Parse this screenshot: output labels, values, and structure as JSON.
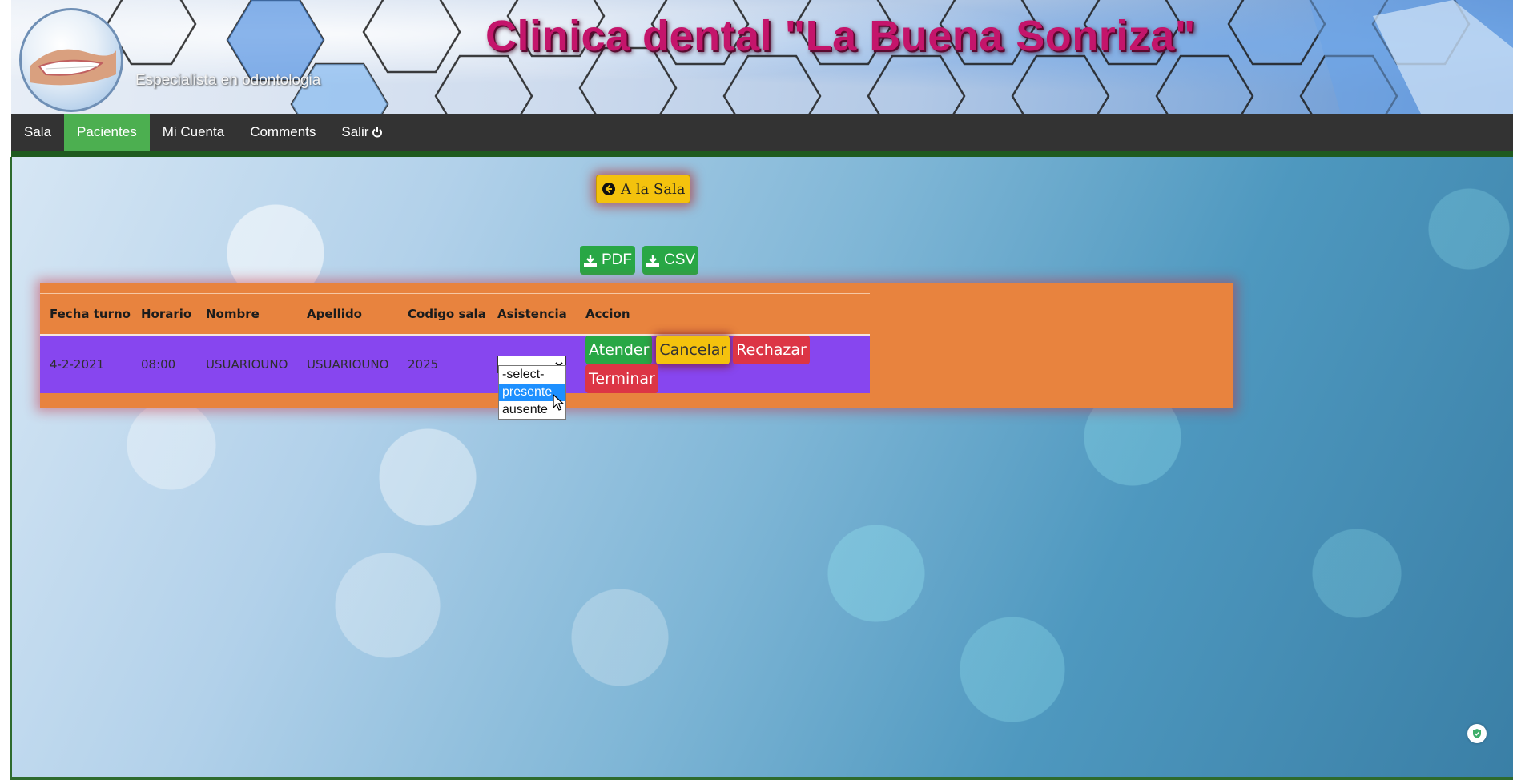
{
  "header": {
    "title": "Clinica dental \"La Buena Sonriza\"",
    "subtitle": "Especialista en odontologia"
  },
  "nav": {
    "items": [
      {
        "label": "Sala",
        "active": false
      },
      {
        "label": "Pacientes",
        "active": true
      },
      {
        "label": "Mi Cuenta",
        "active": false
      },
      {
        "label": "Comments",
        "active": false
      },
      {
        "label": "Salir",
        "active": false,
        "icon": "power-icon"
      }
    ]
  },
  "main": {
    "back_button": {
      "label": "A la Sala",
      "icon": "arrow-circle-left-icon"
    },
    "downloads": [
      {
        "label": "PDF",
        "icon": "download-icon"
      },
      {
        "label": "CSV",
        "icon": "download-icon"
      }
    ],
    "table": {
      "columns": [
        "Fecha turno",
        "Horario",
        "Nombre",
        "Apellido",
        "Codigo sala",
        "Asistencia",
        "Accion"
      ],
      "rows": [
        {
          "fecha": "4-2-2021",
          "horario": "08:00",
          "nombre": "USUARIOUNO",
          "apellido": "USUARIOUNO",
          "codigo": "2025",
          "asistencia": ""
        }
      ]
    },
    "attendance_options": [
      "-select-",
      "presente",
      "ausente"
    ],
    "highlighted_option": "presente",
    "actions": [
      "Atender",
      "Cancelar",
      "Rechazar",
      "Terminar"
    ]
  },
  "colors": {
    "title": "#c4156b",
    "nav_active": "#4caf50",
    "panel": "#e8833e",
    "row": "#8746ef",
    "green": "#28a745",
    "yellow": "#f4c20d",
    "red": "#dc3545"
  }
}
